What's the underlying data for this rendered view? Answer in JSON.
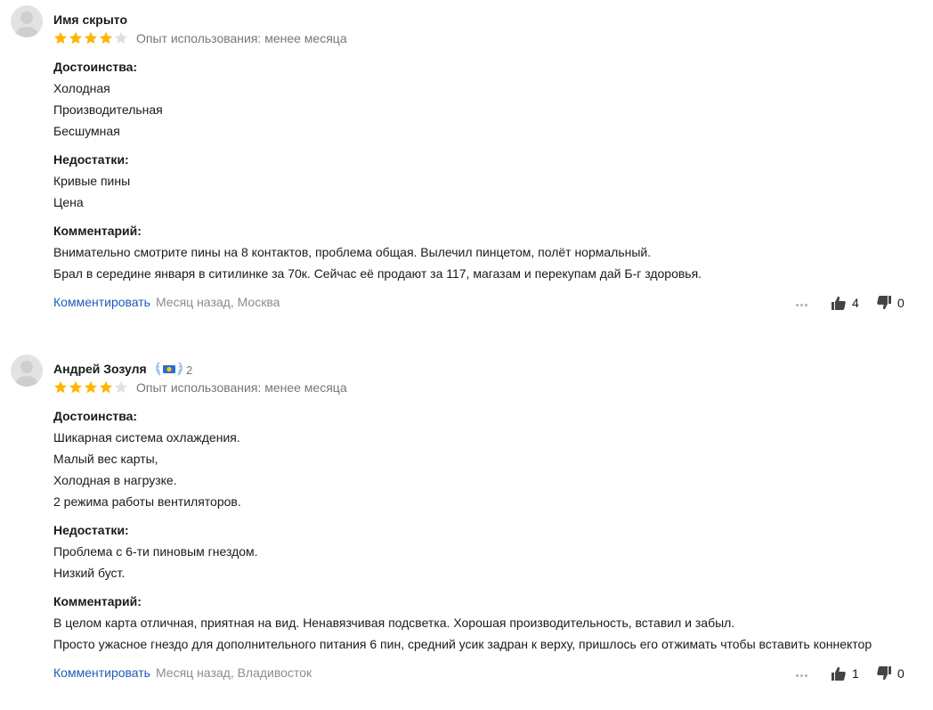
{
  "reviews": [
    {
      "author": "Имя скрыто",
      "badge_count": "",
      "rating": 4,
      "max_rating": 5,
      "experience": "Опыт использования: менее месяца",
      "pros_title": "Достоинства:",
      "pros": [
        "Холодная",
        "Производительная",
        "Бесшумная"
      ],
      "cons_title": "Недостатки:",
      "cons": [
        "Кривые пины",
        "Цена"
      ],
      "comment_title": "Комментарий:",
      "comment": [
        "Внимательно смотрите пины на 8 контактов, проблема общая. Вылечил пинцетом, полёт нормальный.",
        "Брал в середине января в ситилинке за 70к. Сейчас её продают за 117, магазам и перекупам дай Б-г здоровья."
      ],
      "comment_link": "Комментировать",
      "meta": "Месяц назад, Москва",
      "likes": "4",
      "dislikes": "0"
    },
    {
      "author": "Андрей Зозуля",
      "badge_count": "2",
      "rating": 4,
      "max_rating": 5,
      "experience": "Опыт использования: менее месяца",
      "pros_title": "Достоинства:",
      "pros": [
        "Шикарная система охлаждения.",
        "Малый вес карты,",
        "Холодная в нагрузке.",
        "2 режима работы вентиляторов."
      ],
      "cons_title": "Недостатки:",
      "cons": [
        "Проблема с 6-ти пиновым гнездом.",
        "Низкий буст."
      ],
      "comment_title": "Комментарий:",
      "comment": [
        "В целом карта отличная, приятная на вид. Ненавязчивая подсветка. Хорошая производительность, вставил и забыл.",
        "Просто ужасное гнездо для дополнительного питания 6 пин, средний усик задран к верху, пришлось его отжимать чтобы вставить коннектор"
      ],
      "comment_link": "Комментировать",
      "meta": "Месяц назад, Владивосток",
      "likes": "1",
      "dislikes": "0"
    }
  ],
  "colors": {
    "star_filled": "#ffb400",
    "star_empty": "#e0e0e0",
    "link": "#1e5bb8",
    "muted": "#8c8c8c"
  },
  "icons": {
    "avatar": "user-silhouette-icon",
    "badge": "laurel-badge-icon",
    "more": "more-dots-icon",
    "like": "thumbs-up-icon",
    "dislike": "thumbs-down-icon",
    "star": "star-icon"
  }
}
